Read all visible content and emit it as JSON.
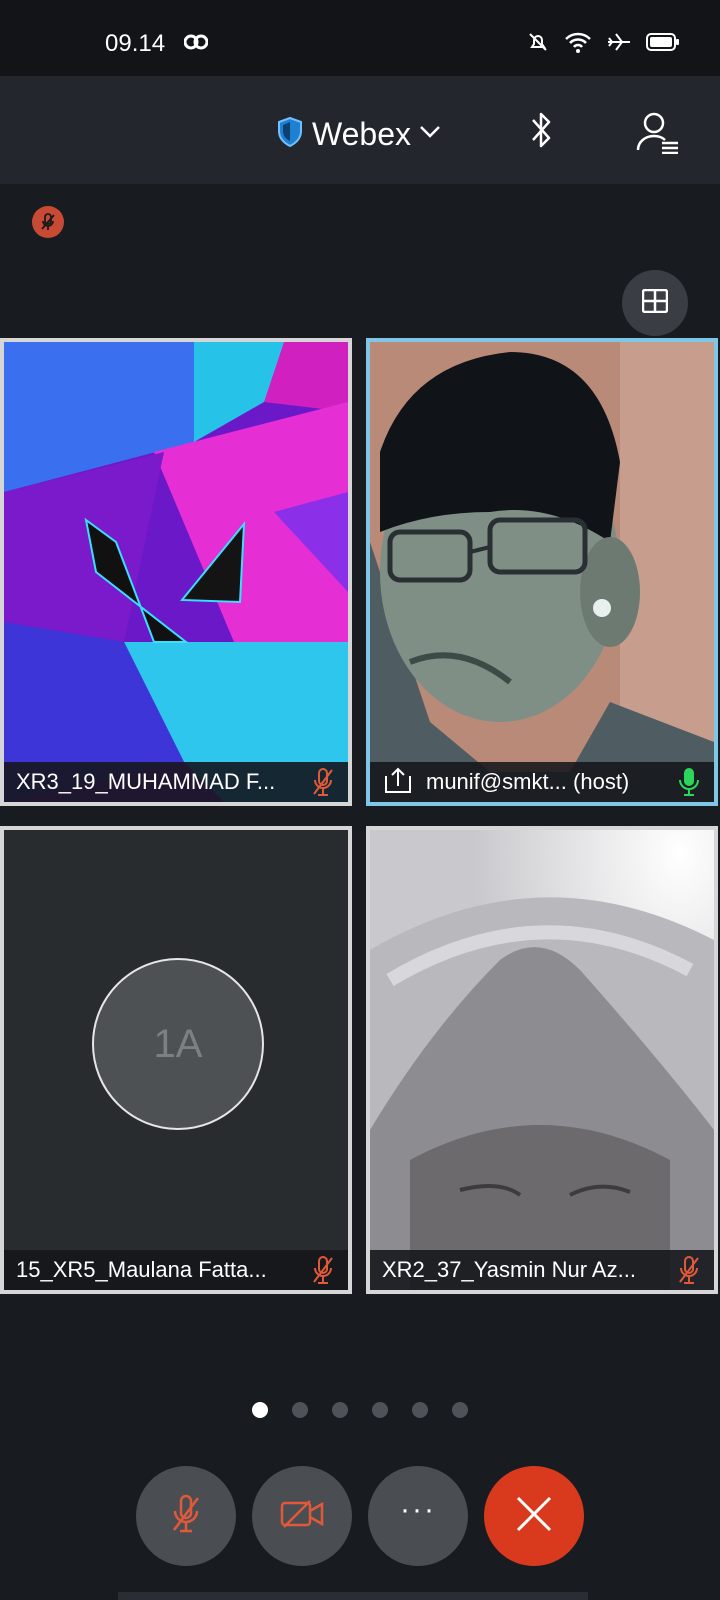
{
  "status_bar": {
    "time": "09.14",
    "icons": [
      "app-notification-icon",
      "mute-bell-icon",
      "wifi-icon",
      "airplane-icon",
      "battery-icon"
    ]
  },
  "header": {
    "title": "Webex",
    "icons": [
      "shield-icon",
      "chevron-down-icon",
      "bluetooth-icon",
      "participants-list-icon"
    ]
  },
  "tiles": [
    {
      "name": "XR3_19_MUHAMMAD F...",
      "mic": "muted"
    },
    {
      "name": "munif@smkt... (host)",
      "mic": "active",
      "sharing_icon": "share-upload-icon"
    },
    {
      "name": "15_XR5_Maulana Fatta...",
      "mic": "muted",
      "avatar_initials": "1A"
    },
    {
      "name": "XR2_37_Yasmin Nur Az...",
      "mic": "muted"
    }
  ],
  "pagination": {
    "pages": 6,
    "current": 1
  },
  "controls": [
    {
      "name": "mute",
      "icon": "mic-off-icon"
    },
    {
      "name": "video",
      "icon": "video-off-icon"
    },
    {
      "name": "more",
      "icon": "more-icon",
      "label": "···"
    },
    {
      "name": "leave",
      "icon": "close-icon"
    }
  ],
  "colors": {
    "accent_active": "#7fc7e6",
    "muted": "#e05a3a",
    "mic_active": "#2bd75a",
    "leave": "#d93a1e"
  }
}
